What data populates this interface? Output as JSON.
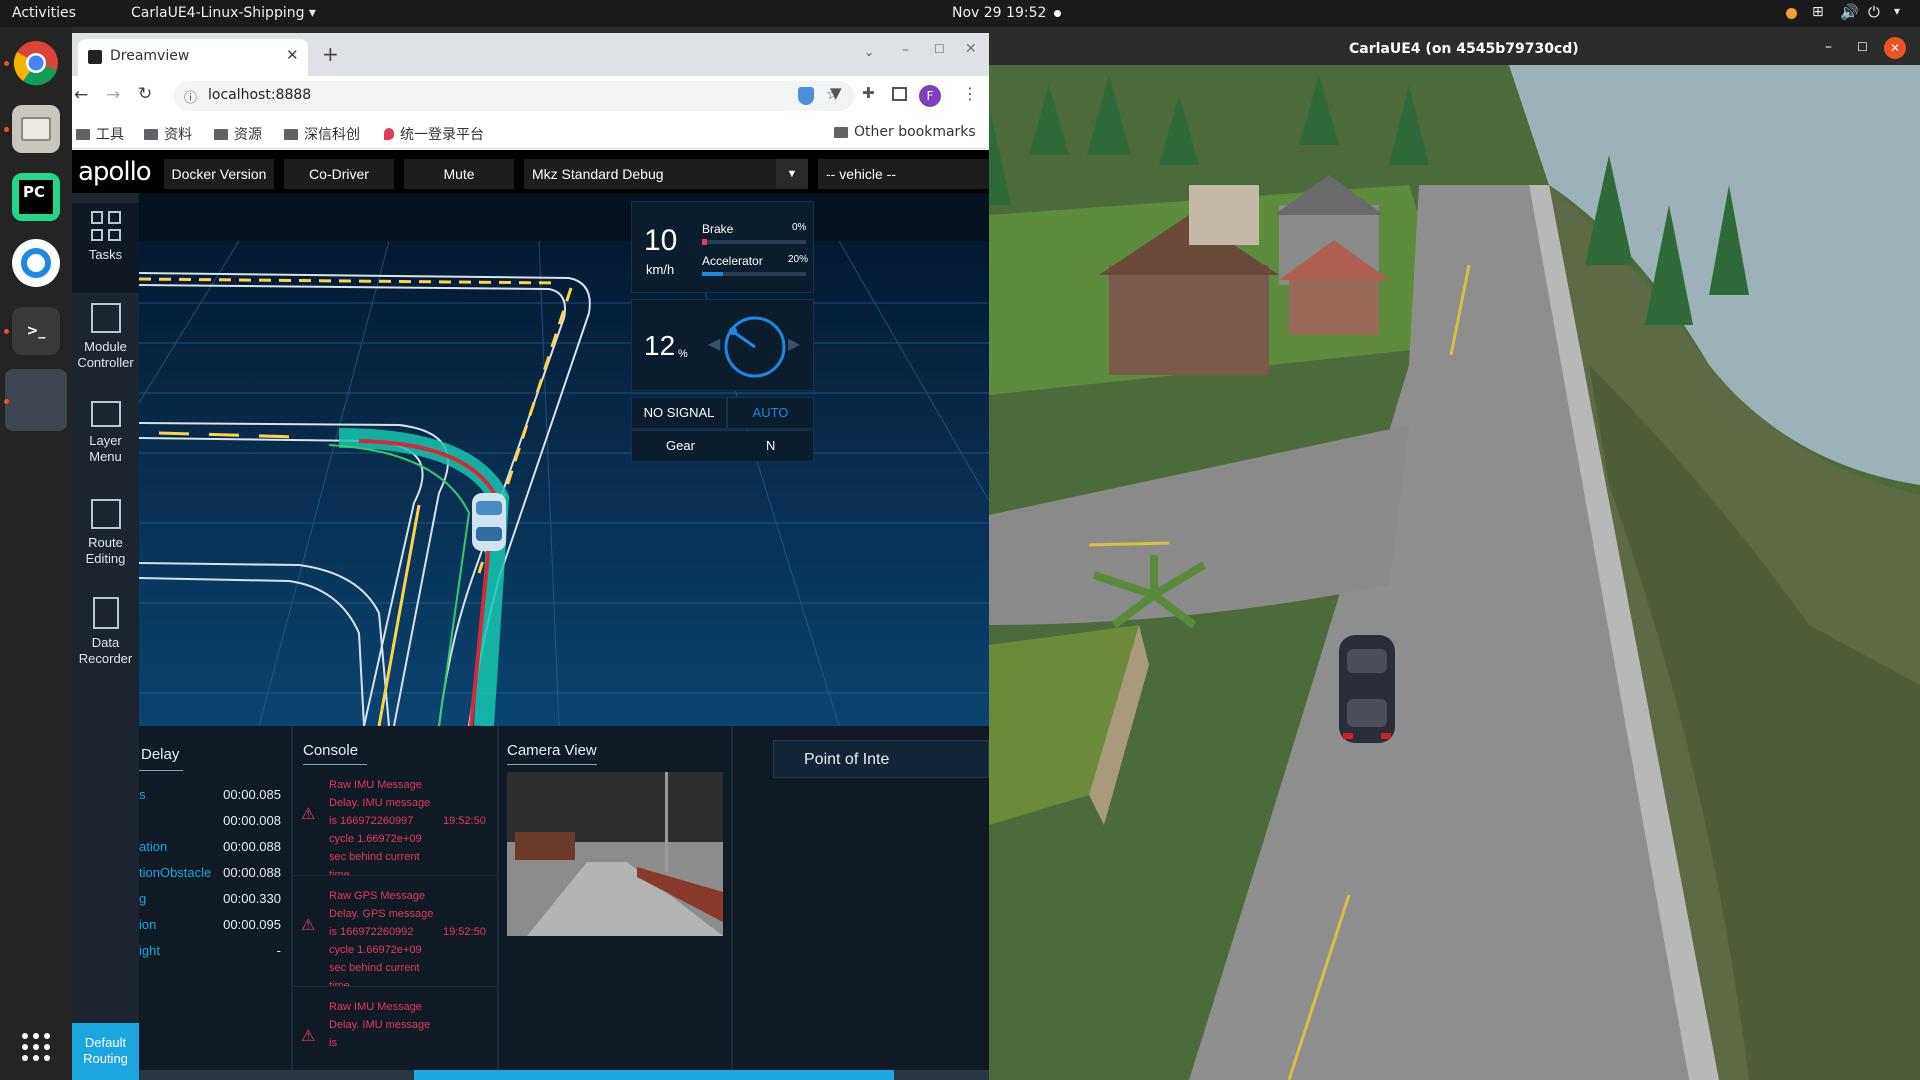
{
  "topbar": {
    "activities": "Activities",
    "app_menu": "CarlaUE4-Linux-Shipping ▾",
    "datetime": "Nov 29  19:52"
  },
  "browser": {
    "tab_title": "Dreamview",
    "url": "localhost:8888",
    "profile_initial": "F",
    "bookmarks": [
      "工具",
      "资料",
      "资源",
      "深信科创",
      "统一登录平台"
    ],
    "other_bookmarks": "Other bookmarks"
  },
  "dreamview": {
    "logo": "apollo",
    "header": {
      "docker_version": "Docker Version",
      "co_driver": "Co-Driver",
      "mute": "Mute",
      "mode_select": "Mkz Standard Debug",
      "vehicle_select": "-- vehicle --"
    },
    "sidebar": [
      {
        "label": "Tasks"
      },
      {
        "label": "Module Controller"
      },
      {
        "label": "Layer Menu"
      },
      {
        "label": "Route Editing"
      },
      {
        "label": "Data Recorder"
      }
    ],
    "default_routing": "Default Routing",
    "dashboard": {
      "speed": "10",
      "speed_unit": "km/h",
      "brake_label": "Brake",
      "brake_value": "0%",
      "brake_level": 0.0,
      "accelerator_label": "Accelerator",
      "accelerator_value": "20%",
      "accelerator_level": 0.2,
      "steering_value": "12",
      "steering_unit": "%",
      "signal": "NO SIGNAL",
      "drive_mode": "AUTO",
      "gear_label": "Gear",
      "gear_value": "N"
    },
    "delay_panel": {
      "title": "Delay",
      "rows": [
        {
          "name": "s",
          "value": "00:00.085"
        },
        {
          "name": "",
          "value": "00:00.008"
        },
        {
          "name": "ation",
          "value": "00:00.088"
        },
        {
          "name": "tionObstacle",
          "value": "00:00.088"
        },
        {
          "name": "g",
          "value": "00:00.330"
        },
        {
          "name": "ion",
          "value": "00:00.095"
        },
        {
          "name": "ight",
          "value": "-"
        }
      ]
    },
    "console_panel": {
      "title": "Console",
      "messages": [
        {
          "text": "Raw IMU Message Delay. IMU message is 166972260997 cycle 1.66972e+09 sec behind current time.",
          "time": "19:52:50"
        },
        {
          "text": "Raw GPS Message Delay. GPS message is 166972260992 cycle 1.66972e+09 sec behind current time.",
          "time": "19:52:50"
        },
        {
          "text": "Raw IMU Message Delay. IMU message is",
          "time": ""
        }
      ]
    },
    "camera_panel": {
      "title": "Camera View"
    },
    "poi_panel": {
      "title": "Point of Inte"
    }
  },
  "carla": {
    "title": "CarlaUE4   (on 4545b79730cd)"
  },
  "colors": {
    "accent_blue": "#1e88e5",
    "warning_red": "#e23a5a",
    "dock_accent": "#e95420"
  }
}
